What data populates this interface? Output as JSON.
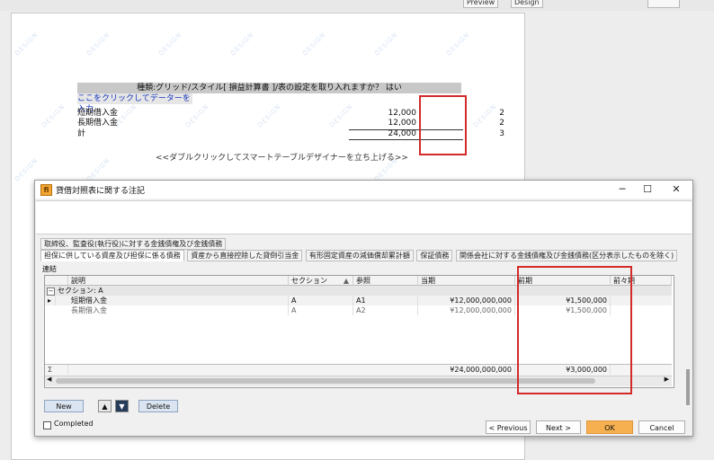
{
  "toolbar": {
    "preview_label": "Preview",
    "design_label": "Design"
  },
  "document": {
    "watermark": "DESIGN",
    "banner_text": "種類:グリッド/スタイル[ 損益計算書 ]/表の設定を取り入れますか？ はい",
    "click_link": "ここをクリックしてデーターを入力",
    "rows": [
      {
        "label": "短期借入金",
        "amount": "12,000",
        "count": "2"
      },
      {
        "label": "長期借入金",
        "amount": "12,000",
        "count": "2"
      },
      {
        "label": "計",
        "amount": "24,000",
        "count": "3"
      }
    ],
    "hint": "<<ダブルクリックしてスマートテーブルデザイナーを立ち上げる>>"
  },
  "dialog": {
    "title": "貸借対照表に関する注記",
    "tabs_row1": [
      "取締役、監査役(執行役)に対する金銭債権及び金銭債務"
    ],
    "tabs_row2": [
      "担保に供している資産及び担保に係る債務",
      "資産から直接控除した貸倒引当金",
      "有形固定資産の減価償却累計額",
      "保証債務",
      "関係会社に対する金銭債権及び金銭債務(区分表示したものを除く)"
    ],
    "panel_label": "連結",
    "grid": {
      "headers": [
        "説明",
        "セクション",
        "参照",
        "当期",
        "前期",
        "前々期"
      ],
      "group": "セクション: A",
      "rows": [
        {
          "desc": "短期借入金",
          "section": "A",
          "ref": "A1",
          "current": "¥12,000,000,000",
          "prior": "¥1,500,000"
        },
        {
          "desc": "長期借入金",
          "section": "A",
          "ref": "A2",
          "current": "¥12,000,000,000",
          "prior": "¥1,500,000"
        }
      ],
      "sum_symbol": "Σ",
      "sum_current": "¥24,000,000,000",
      "sum_prior": "¥3,000,000"
    },
    "buttons": {
      "new": "New",
      "delete": "Delete",
      "previous": "< Previous",
      "next": "Next >",
      "ok": "OK",
      "cancel": "Cancel"
    },
    "completed_label": "Completed",
    "window_controls": {
      "minimize": "─",
      "maximize": "☐",
      "close": "✕"
    }
  },
  "colors": {
    "highlight": "#d32a2a",
    "ok_button": "#f6b04f",
    "link": "#1434c0"
  }
}
